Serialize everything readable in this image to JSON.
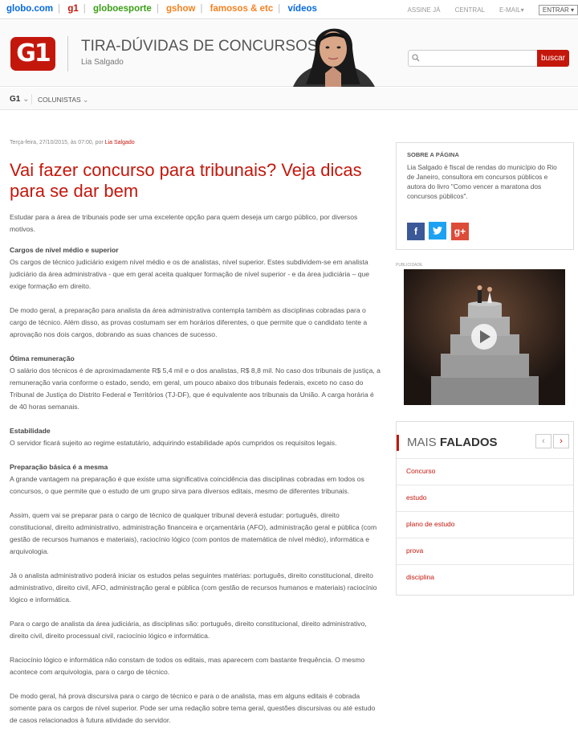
{
  "topbar": {
    "links": [
      "globo.com",
      "g1",
      "globoesporte",
      "gshow",
      "famosos & etc",
      "vídeos"
    ],
    "link_colors": [
      "#0669de",
      "#c4170c",
      "#3a9f16",
      "#f58220",
      "#f58220",
      "#0669de"
    ],
    "assine": "ASSINE JÁ",
    "central": "CENTRAL",
    "email": "E-MAIL",
    "entrar": "ENTRAR"
  },
  "header": {
    "logo": "G1",
    "title": "TIRA-DÚVIDAS DE CONCURSOS",
    "author": "Lia Salgado",
    "search_placeholder": "",
    "search_button": "buscar"
  },
  "nav": {
    "g1": "G1",
    "colunistas": "COLUNISTAS"
  },
  "article": {
    "meta_prefix": "Terça-feira, 27/10/2015, às 07:00, por",
    "meta_author": "Lia Salgado",
    "title": "Vai fazer concurso para tribunais? Veja dicas para se dar bem",
    "lead": "Estudar para a área de tribunais pode ser uma excelente opção para quem deseja um cargo público, por diversos motivos.",
    "sections": [
      {
        "heading": "Cargos de nível médio e superior",
        "paragraphs": [
          "Os cargos de técnico judiciário exigem nível médio e os de analistas, nível superior. Estes subdividem-se em analista judiciário da área administrativa - que em geral aceita qualquer formação de nível superior - e da área judiciária – que exige formação em direito.",
          "De modo geral, a preparação para analista da área administrativa contempla também as disciplinas cobradas para o cargo de técnico. Além disso, as provas costumam ser em horários diferentes, o que permite que o candidato tente a aprovação nos dois cargos, dobrando as suas chances de sucesso."
        ]
      },
      {
        "heading": "Ótima remuneração",
        "paragraphs": [
          "O salário dos técnicos é de aproximadamente R$ 5,4 mil e o dos analistas, R$ 8,8 mil. No caso dos tribunais de justiça, a remuneração varia conforme o estado, sendo, em geral, um pouco abaixo dos tribunais federais, exceto no caso do Tribunal de Justiça do Distrito Federal e Territórios (TJ-DF), que é equivalente aos tribunais da União. A carga horária é de 40 horas semanais."
        ]
      },
      {
        "heading": "Estabilidade",
        "paragraphs": [
          "O servidor ficará sujeito ao regime estatutário, adquirindo estabilidade após cumpridos os requisitos legais."
        ]
      },
      {
        "heading": "Preparação básica é a mesma",
        "paragraphs": [
          "A grande vantagem na preparação é que existe uma significativa coincidência das disciplinas cobradas em todos os concursos, o que permite que o estudo de um grupo sirva para diversos editais, mesmo de diferentes tribunais.",
          "Assim, quem vai se preparar para o cargo de técnico de qualquer tribunal deverá estudar: português, direito constitucional, direito administrativo, administração financeira e orçamentária (AFO), administração geral e pública (com gestão de recursos humanos e materiais), raciocínio lógico (com pontos de matemática de nível médio), informática e arquivologia.",
          "Já o analista administrativo poderá iniciar os estudos pelas seguintes matérias: português, direito constitucional, direito administrativo, direito civil, AFO, administração geral e pública (com gestão de recursos humanos e materiais) raciocínio lógico e informática.",
          "Para o cargo de analista da área judiciária, as disciplinas são: português, direito constitucional, direito administrativo, direito civil, direito processual civil, raciocínio lógico e informática.",
          "Raciocínio lógico e informática não constam de todos os editais, mas aparecem com bastante frequência. O mesmo acontece com arquivologia, para o cargo de técnico.",
          "De modo geral, há prova discursiva para o cargo de técnico e para o de analista, mas em alguns editais é cobrada somente para os cargos de nível superior. Pode ser uma redação sobre tema geral, questões discursivas ou até estudo de casos relacionados à futura atividade do servidor."
        ]
      }
    ]
  },
  "sidebar": {
    "about_title": "SOBRE A PÁGINA",
    "about_text": "Lia Salgado é fiscal de rendas do município do Rio de Janeiro, consultora em concursos públicos e autora do livro \"Como vencer a maratona dos concursos públicos\".",
    "social": [
      "f",
      "t",
      "g+"
    ],
    "publicidade": "PUBLICIDADE",
    "mais_light": "MAIS",
    "mais_bold": "FALADOS",
    "prev": "‹",
    "next": "›",
    "tags": [
      "Concurso",
      "estudo",
      "plano de estudo",
      "prova",
      "disciplina"
    ]
  },
  "colors": {
    "brand_red": "#c4170c",
    "text": "#555555"
  }
}
